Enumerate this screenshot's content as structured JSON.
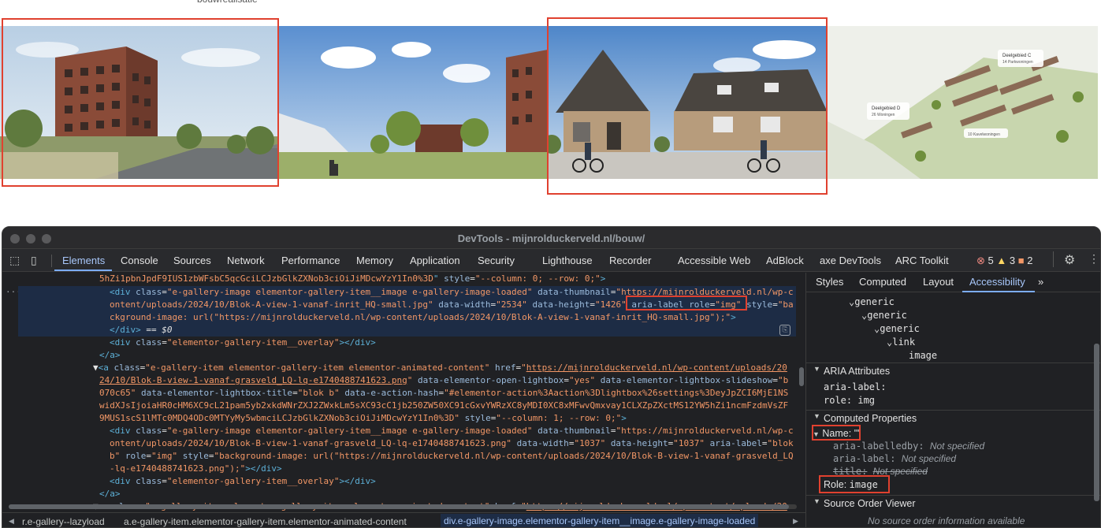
{
  "page": {
    "cut_text": "bouwrealisatie"
  },
  "gallery": {
    "items": [
      {
        "alt": "Blok A view 1 vanaf inrit"
      },
      {
        "alt": "Blok B view 1 vanaf grasveld"
      },
      {
        "alt": "Houses with cyclists"
      },
      {
        "alt": "Aerial site plan"
      }
    ],
    "aerial_labels": [
      "Deelgebied C",
      "14 Parkwoningen",
      "Deelgebied D",
      "26 Woningen",
      "10 Kavelwoningen"
    ]
  },
  "devtools": {
    "title": "DevTools - mijnrolduckerveld.nl/bouw/",
    "tabs": [
      "Elements",
      "Console",
      "Sources",
      "Network",
      "Performance",
      "Memory",
      "Application",
      "Security",
      "Lighthouse",
      "Recorder",
      "Accessible Web",
      "AdBlock",
      "axe DevTools",
      "ARC Toolkit"
    ],
    "errors": "5",
    "warnings": "3",
    "issues": "2",
    "code": {
      "l0_val": "5hZi1pbnJpdF9IUS1zbWFsbC5qcGciLCJzbGlkZXNob3ciOiJiMDcwYzY1In0%3D",
      "l0_style": "--column: 0; --row: 0;",
      "l1_class": "e-gallery-image elementor-gallery-item__image e-gallery-image-loaded",
      "l1_thumb_a": "https://mijnrolduckerveld.nl/wp-c",
      "l2_thumb_b": "ontent/uploads/2024/10/Blok-A-view-1-vanaf-inrit_HQ-small.jpg",
      "l2_width": "2534",
      "l2_height": "1426",
      "l3_style": "ckground-image: url(\"https://mijnrolduckerveld.nl/wp-content/uploads/2024/10/Blok-A-view-1-vanaf-inrit_HQ-small.jpg\");",
      "l4_eq": "== $0",
      "overlay_class": "elementor-gallery-item__overlay",
      "a_class": "e-gallery-item elementor-gallery-item elementor-animated-content",
      "a_href1": "https://mijnrolduckerveld.nl/wp-content/uploads/20",
      "a_href2": "24/10/Blok-B-view-1-vanaf-grasveld_LQ-lq-e1740488741623.png",
      "lightbox_slide_a": "b",
      "lightbox_slide_b": "070c65",
      "lightbox_title": "blok b",
      "action_hash_a": "#elementor-action%3Aaction%3Dlightbox%26settings%3DeyJpZCI6MjE1NS",
      "action_hash_b": "widXJsIjoiaHR0cHM6XC9cL21pam5yb2xkdWNrZXJ2ZWxkLm5sXC93cC1jb250ZW50XC91cGxvYWRzXC8yMDI0XC8xMFwvQmxvay1CLXZpZXctMS12YW5hZi1ncmFzdmVsZF",
      "action_hash_c": "9MUS1scS1lMTc0MDQ4ODc0MTYyMy5wbmciLCJzbGlkZXNob3ciOiJiMDcwYzY1In0%3D",
      "a_style": "--column: 1; --row: 0;",
      "b_thumb_a": "https://mijnrolduckerveld.nl/wp-c",
      "b_thumb_b": "ontent/uploads/2024/10/Blok-B-view-1-vanaf-grasveld_LQ-lq-e1740488741623.png",
      "b_width": "1037",
      "b_height": "1037",
      "b_aria_a": "blok",
      "b_aria_b": "b",
      "b_style_a": "background-image: url(\"https://mijnrolduckerveld.nl/wp-content/uploads/2024/10/Blok-B-view-1-vanaf-grasveld_LQ",
      "b_style_b": "-lq-e1740488741623.png\");",
      "last_href": "https://mijnrolduckerveld.nl/wp-content/uploads/20"
    },
    "sidebar": {
      "tabs": [
        "Styles",
        "Computed",
        "Layout",
        "Accessibility"
      ],
      "tree": [
        "generic",
        "generic",
        "generic",
        "link",
        "image"
      ],
      "aria_section": "ARIA Attributes",
      "aria_label_key": "aria-label:",
      "role_key": "role:",
      "role_val": "img",
      "computed_section": "Computed Properties",
      "name_key": "Name:",
      "name_val": "\"\"",
      "labelledby_key": "aria-labelledby:",
      "labelledby_val": "Not specified",
      "arialabel_key": "aria-label:",
      "arialabel_val": "Not specified",
      "title_key": "title:",
      "title_val": "Not specified",
      "role_line_key": "Role:",
      "role_line_val": "image",
      "source_section": "Source Order Viewer",
      "no_source": "No source order information available"
    },
    "breadcrumbs": [
      "r.e-gallery--lazyload",
      "a.e-gallery-item.elementor-gallery-item.elementor-animated-content",
      "div.e-gallery-image.elementor-gallery-item__image.e-gallery-image-loaded"
    ]
  }
}
